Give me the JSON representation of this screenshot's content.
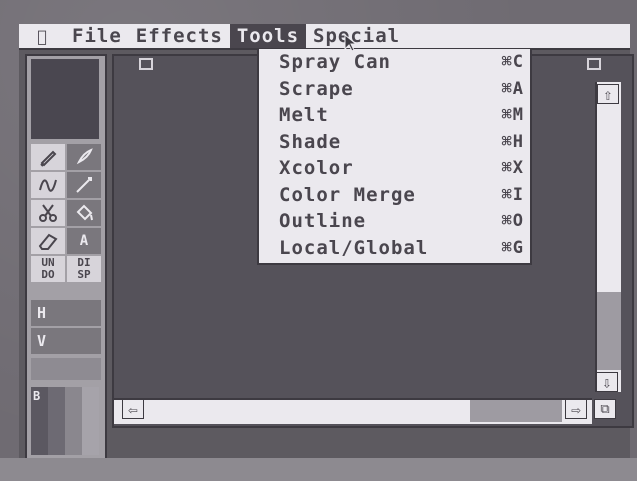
{
  "menubar": {
    "apple_icon": "apple-logo",
    "menus": [
      "File",
      "Effects",
      "Tools",
      "Special"
    ],
    "active_menu": "Tools"
  },
  "tools_menu": {
    "items": [
      {
        "label": "Spray Can",
        "shortcut": "⌘C"
      },
      {
        "label": "Scrape",
        "shortcut": "⌘A"
      },
      {
        "label": "Melt",
        "shortcut": "⌘M"
      },
      {
        "label": "Shade",
        "shortcut": "⌘H"
      },
      {
        "label": "Xcolor",
        "shortcut": "⌘X"
      },
      {
        "label": "Color Merge",
        "shortcut": "⌘I"
      },
      {
        "label": "Outline",
        "shortcut": "⌘O"
      },
      {
        "label": "Local/Global",
        "shortcut": "⌘G"
      }
    ]
  },
  "palette": {
    "text_tool": "A",
    "undo": "UN\nDO",
    "disp": "DI\nSP",
    "h": "H",
    "v": "V",
    "color_label": "B"
  },
  "scroll": {
    "up": "⇧",
    "down": "⇩",
    "left": "⇦",
    "right": "⇨"
  }
}
